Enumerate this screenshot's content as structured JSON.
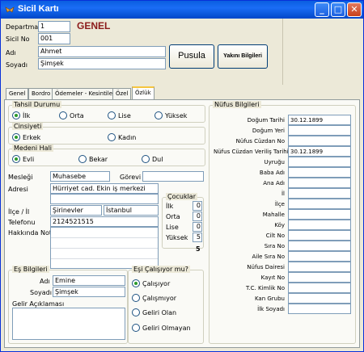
{
  "window": {
    "title": "Sicil Kartı"
  },
  "header": {
    "departman_label": "Departman",
    "departman_value": "1",
    "genel_label": "GENEL",
    "sicil_label": "Sicil No",
    "sicil_value": "001",
    "adi_label": "Adı",
    "adi_value": "Ahmet",
    "soyadi_label": "Soyadı",
    "soyadi_value": "Şimşek",
    "pusula_button": "Pusula",
    "yakini_button": "Yakını Bilgileri"
  },
  "tabs": [
    "Genel",
    "Bordro",
    "Ödemeler - Kesintiler",
    "Özel",
    "Özlük"
  ],
  "active_tab": "Özlük",
  "tahsil": {
    "title": "Tahsil Durumu",
    "options": [
      "İlk",
      "Orta",
      "Lise",
      "Yüksek"
    ],
    "selected": "İlk"
  },
  "cinsiyet": {
    "title": "Cinsiyeti",
    "options": [
      "Erkek",
      "Kadın"
    ],
    "selected": "Erkek"
  },
  "medeni": {
    "title": "Medeni Hali",
    "options": [
      "Evli",
      "Bekar",
      "Dul"
    ],
    "selected": "Evli"
  },
  "personal": {
    "meslegi_label": "Mesleği",
    "meslegi_value": "Muhasebe",
    "gorevi_label": "Görevi",
    "gorevi_value": "",
    "adresi_label": "Adresi",
    "adres_line1": "Hürriyet cad. Ekin iş merkezi",
    "adres_line2": "",
    "ilce_label": "İlçe / İl",
    "ilce_value": "Şirinevler",
    "il_value": "İstanbul",
    "telefonu_label": "Telefonu",
    "telefonu_value": "2124521515",
    "hakkinda_label": "Hakkında Notlar"
  },
  "cocuklar": {
    "title": "Çocuklar",
    "rows": [
      {
        "label": "İlk",
        "value": "0"
      },
      {
        "label": "Orta",
        "value": "0"
      },
      {
        "label": "Lise",
        "value": "0"
      },
      {
        "label": "Yüksek",
        "value": "5"
      }
    ],
    "total": "5"
  },
  "es": {
    "title": "Eş Bilgileri",
    "adi_label": "Adı",
    "adi_value": "Emine",
    "soyadi_label": "Soyadı",
    "soyadi_value": "Şimşek",
    "gelir_label": "Gelir Açıklaması"
  },
  "es_calisma": {
    "title": "Eşi Çalışıyor mu?",
    "options": [
      "Çalışıyor",
      "Çalışmıyor",
      "Geliri Olan",
      "Geliri Olmayan"
    ],
    "selected": "Çalışıyor"
  },
  "nufus": {
    "title": "Nüfus Bilgileri",
    "fields": [
      {
        "label": "Doğum Tarihi",
        "value": "30.12.1899"
      },
      {
        "label": "Doğum Yeri",
        "value": ""
      },
      {
        "label": "Nüfus Cüzdan No",
        "value": ""
      },
      {
        "label": "Nüfus Cüzdan Veriliş Tarihi",
        "value": "30.12.1899"
      },
      {
        "label": "Uyruğu",
        "value": ""
      },
      {
        "label": "Baba Adı",
        "value": ""
      },
      {
        "label": "Ana Adı",
        "value": ""
      },
      {
        "label": "İl",
        "value": ""
      },
      {
        "label": "İlçe",
        "value": ""
      },
      {
        "label": "Mahalle",
        "value": ""
      },
      {
        "label": "Köy",
        "value": ""
      },
      {
        "label": "Cilt No",
        "value": ""
      },
      {
        "label": "Sıra No",
        "value": ""
      },
      {
        "label": "Aile Sıra No",
        "value": ""
      },
      {
        "label": "Nüfus Dairesi",
        "value": ""
      },
      {
        "label": "Kayıt No",
        "value": ""
      },
      {
        "label": "T.C. Kimlik No",
        "value": ""
      },
      {
        "label": "Kan Grubu",
        "value": ""
      },
      {
        "label": "İlk Soyadı",
        "value": ""
      }
    ]
  }
}
